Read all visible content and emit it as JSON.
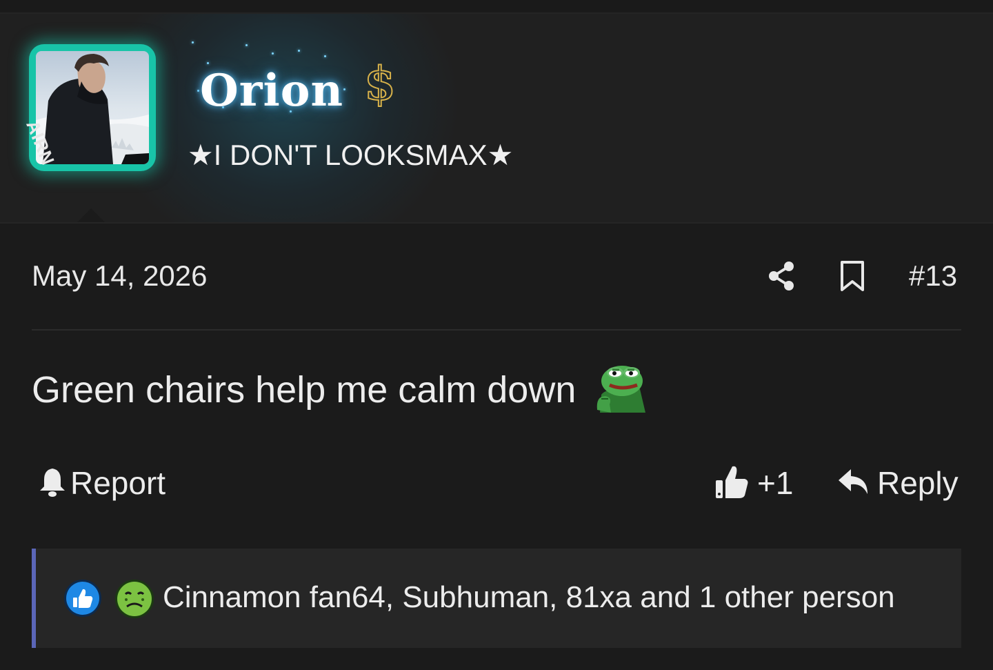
{
  "user": {
    "name": "Orion",
    "badge": "$",
    "title": "★I DON'T LOOKSMAX★",
    "avatar_text": "AIRN"
  },
  "post": {
    "date": "May 14, 2026",
    "number": "#13",
    "message": "Green chairs help me calm down",
    "emoji": "pepe-thinking"
  },
  "actions": {
    "report_label": "Report",
    "like_count": "+1",
    "reply_label": "Reply"
  },
  "reactions": {
    "icons": [
      "like-reaction-icon",
      "sick-reaction-icon"
    ],
    "text": "Cinnamon fan64, Subhuman, 81xa and 1 other person"
  },
  "colors": {
    "avatar_border": "#18c4a8",
    "username_glow": "#5ac8ff",
    "badge_gold": "#d8b24a",
    "reaction_bar": "#5b66b8",
    "like_blue": "#1e88e5",
    "sick_green": "#7cc242"
  }
}
